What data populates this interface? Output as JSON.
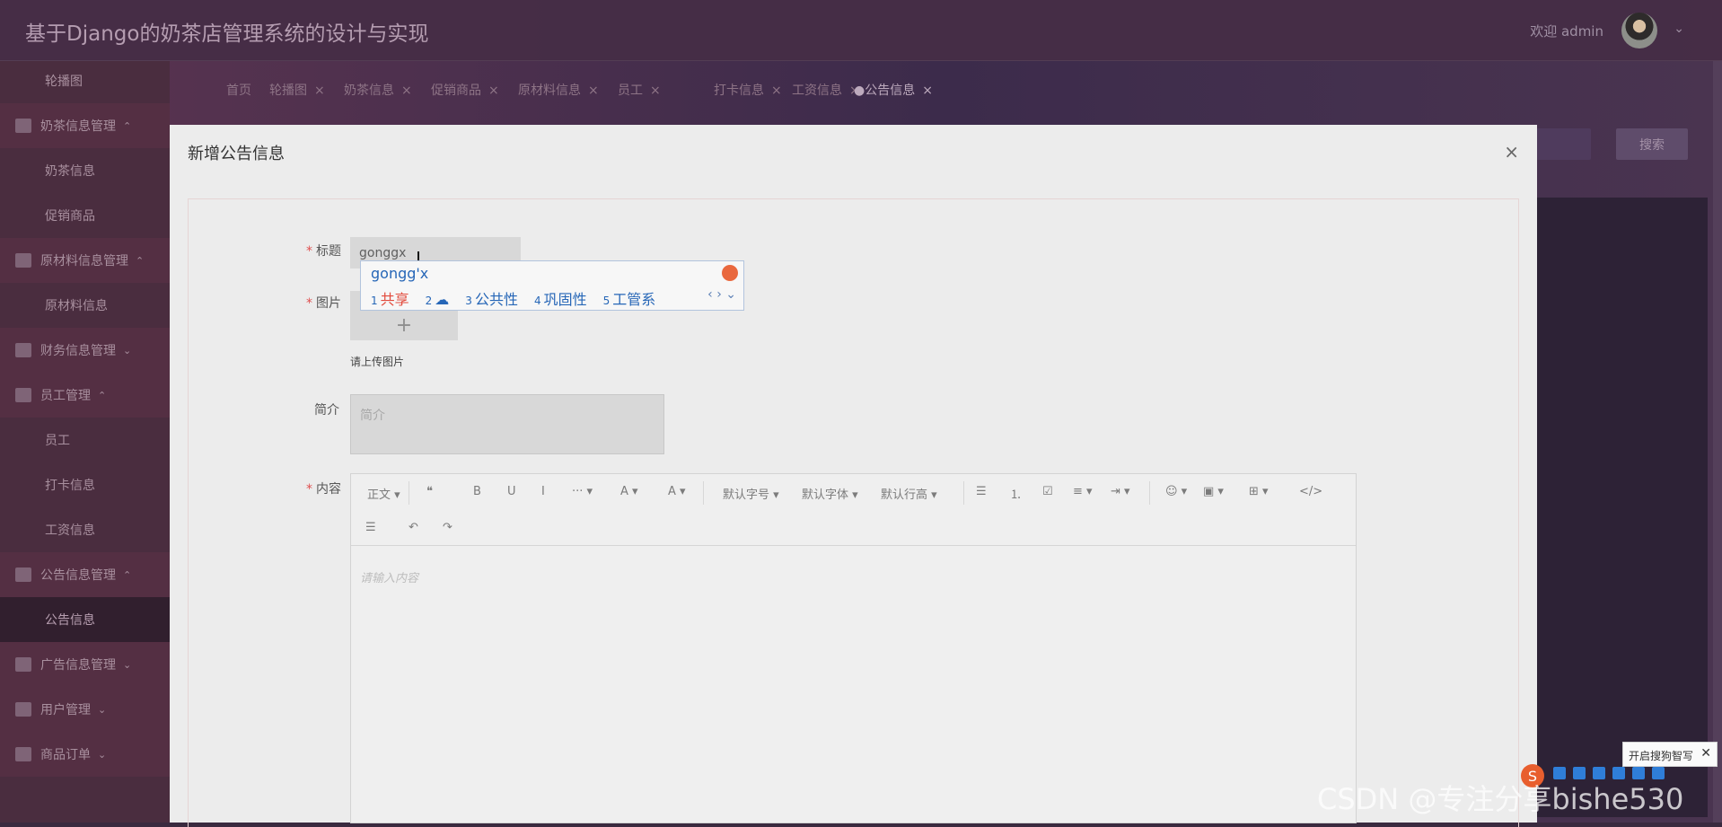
{
  "header": {
    "title": "基于Django的奶茶店管理系统的设计与实现",
    "welcome": "欢迎 admin",
    "avatar_icon": "avatar",
    "chevron": "chevron-down-icon"
  },
  "sidebar": {
    "items": [
      {
        "label": "轮播图",
        "type": "child"
      },
      {
        "label": "奶茶信息管理",
        "type": "group",
        "expanded": true
      },
      {
        "label": "奶茶信息",
        "type": "child"
      },
      {
        "label": "促销商品",
        "type": "child"
      },
      {
        "label": "原材料信息管理",
        "type": "group",
        "expanded": true
      },
      {
        "label": "原材料信息",
        "type": "child"
      },
      {
        "label": "财务信息管理",
        "type": "group",
        "expanded": false
      },
      {
        "label": "员工管理",
        "type": "group",
        "expanded": true
      },
      {
        "label": "员工",
        "type": "child"
      },
      {
        "label": "打卡信息",
        "type": "child"
      },
      {
        "label": "工资信息",
        "type": "child"
      },
      {
        "label": "公告信息管理",
        "type": "group",
        "expanded": true
      },
      {
        "label": "公告信息",
        "type": "child",
        "active": true
      },
      {
        "label": "广告信息管理",
        "type": "group",
        "expanded": false
      },
      {
        "label": "用户管理",
        "type": "group",
        "expanded": false
      },
      {
        "label": "商品订单",
        "type": "group",
        "expanded": false
      }
    ]
  },
  "tabs": [
    {
      "label": "首页",
      "closable": false
    },
    {
      "label": "轮播图",
      "closable": true
    },
    {
      "label": "奶茶信息",
      "closable": true
    },
    {
      "label": "促销商品",
      "closable": true
    },
    {
      "label": "原材料信息",
      "closable": true
    },
    {
      "label": "员工",
      "closable": true
    },
    {
      "label": "打卡信息",
      "closable": true
    },
    {
      "label": "工资信息",
      "closable": true
    },
    {
      "label": "●公告信息",
      "closable": true,
      "active": true
    }
  ],
  "search_button": "搜索",
  "modal": {
    "title": "新增公告信息",
    "close": "×",
    "fields": {
      "title_label": "标题",
      "title_value": "gonggx",
      "image_label": "图片",
      "upload_plus": "+",
      "upload_hint": "请上传图片",
      "intro_label": "简介",
      "intro_placeholder": "简介",
      "content_label": "内容",
      "content_placeholder": "请输入内容"
    },
    "toolbar": {
      "row1": [
        "正文 ▾",
        "❝",
        "B",
        "U",
        "I",
        "··· ▾",
        "A ▾",
        "A ▾",
        "默认字号 ▾",
        "默认字体 ▾",
        "默认行高 ▾",
        "☰",
        "⒈",
        "☑",
        "≡ ▾",
        "⇥ ▾",
        "☺ ▾",
        "▣ ▾",
        "⊞ ▾",
        "</>"
      ],
      "row2": [
        "☰",
        "↶",
        "↷"
      ]
    }
  },
  "ime": {
    "input": "gongg'x",
    "candidates": [
      "共享",
      "",
      "公共性",
      "巩固性",
      "工管系"
    ],
    "numbers": [
      "1",
      "2",
      "3",
      "4",
      "5"
    ]
  },
  "sogou_hint": "开启搜狗智写",
  "watermark": "CSDN @专注分享bishe530",
  "colors": {
    "accent": "#2666b7",
    "danger": "#e04f4f"
  }
}
